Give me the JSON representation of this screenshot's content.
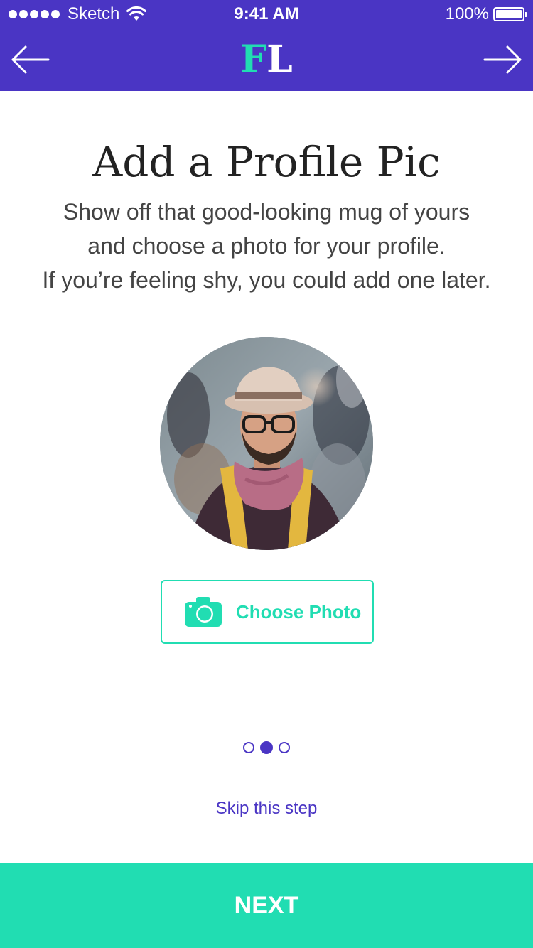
{
  "status_bar": {
    "carrier": "Sketch",
    "time": "9:41 AM",
    "battery": "100%",
    "battery_level": 1.0,
    "signal_strength": 5
  },
  "header": {
    "back_icon": "arrow-left-icon",
    "forward_icon": "arrow-right-icon",
    "logo_first": "F",
    "logo_second": "L"
  },
  "main": {
    "title": "Add a Profile Pic",
    "description_lines": [
      "Show off that good-looking mug of yours",
      "and choose a photo for your profile.",
      "If you’re feeling shy, you could add one later."
    ],
    "choose_photo_label": "Choose Photo",
    "choose_photo_icon": "camera-icon",
    "pager": {
      "total": 3,
      "active": 1
    },
    "skip_label": "Skip this step"
  },
  "footer": {
    "next_label": "NEXT"
  },
  "colors": {
    "primary": "#4a35c4",
    "accent": "#21ddb2",
    "text": "#222222",
    "white": "#ffffff"
  }
}
